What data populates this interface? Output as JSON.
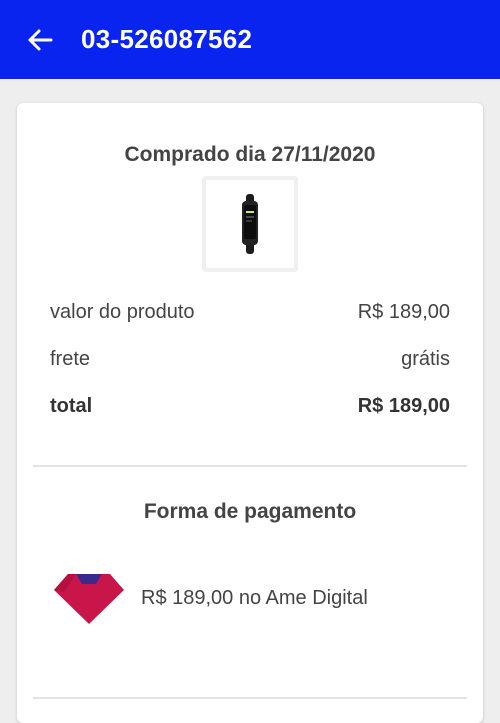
{
  "header": {
    "order_number": "03-526087562",
    "back_icon": "arrow-left-icon",
    "color": "#0a24f0"
  },
  "order": {
    "purchase_date": "Comprado dia 27/11/2020",
    "product_image": "smart-band-image",
    "rows": [
      {
        "label": "valor do produto",
        "value": "R$ 189,00"
      },
      {
        "label": "frete",
        "value": "grátis"
      },
      {
        "label": "total",
        "value": "R$ 189,00"
      }
    ]
  },
  "payment": {
    "title": "Forma de pagamento",
    "method_icon": "ame-digital-icon",
    "method_text": "R$ 189,00 no Ame Digital",
    "icon_colors": {
      "primary": "#c8164a",
      "secondary": "#3a2a8c"
    }
  }
}
